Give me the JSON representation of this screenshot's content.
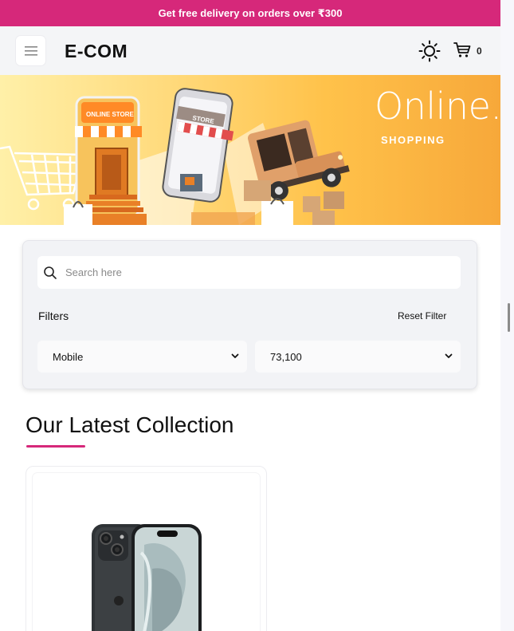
{
  "promo": {
    "text": "Get free delivery on orders over ₹300"
  },
  "header": {
    "logo": "E-COM",
    "cart_count": "0"
  },
  "hero": {
    "title": "Online.",
    "subtitle": "SHOPPING",
    "store_sign": "ONLINE STORE",
    "phone_sign": "STORE"
  },
  "filters": {
    "search_placeholder": "Search here",
    "label": "Filters",
    "reset_label": "Reset Filter",
    "category_selected": "Mobile",
    "price_selected": "73,100"
  },
  "collection": {
    "title": "Our Latest Collection"
  },
  "colors": {
    "accent": "#d6287a"
  }
}
